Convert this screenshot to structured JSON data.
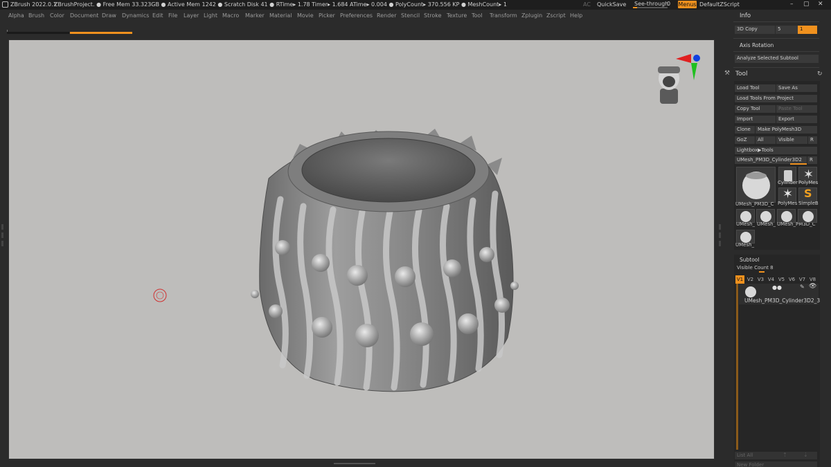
{
  "titlebar": {
    "app": "ZBrush 2022.0.1",
    "project": "ZBrushProject",
    "stats": ". ● Free Mem 33.323GB ● Active Mem 1242 ● Scratch Disk 41 ●  RTime▸ 1.78 Timer▸ 1.684 ATime▸ 0.004 ● PolyCount▸ 370.556 KP  ● MeshCount▸ 1",
    "ac": "AC",
    "quicksave": "QuickSave",
    "seethrough_label": "See-through",
    "seethrough_value": "0",
    "seethrough_level": 0.0,
    "menus": "Menus",
    "script": "DefaultZScript",
    "controls": [
      "–",
      "▢",
      "✕"
    ]
  },
  "menubar": [
    "Alpha",
    "Brush",
    "Color",
    "Document",
    "Draw",
    "Dynamics",
    "Edit",
    "File",
    "Layer",
    "Light",
    "Macro",
    "Marker",
    "Material",
    "Movie",
    "Picker",
    "Preferences",
    "Render",
    "Stencil",
    "Stroke",
    "Texture",
    "Tool",
    "Transform",
    "Zplugin",
    "Zscript",
    "Help"
  ],
  "panel": {
    "info": "Info",
    "copy3d": "3D Copy",
    "copy3d_value": "5",
    "copy3d_value2": "1",
    "axis_rotation": "Axis Rotation",
    "analyze": "Analyze Selected Subtool",
    "tool_title": "Tool",
    "load_tool": "Load Tool",
    "save_as": "Save As",
    "load_project": "Load Tools From Project",
    "copy_tool": "Copy Tool",
    "paste_tool": "Paste Tool",
    "import": "Import",
    "export": "Export",
    "clone": "Clone",
    "make_polymesh": "Make PolyMesh3D",
    "goz": "GoZ",
    "all": "All",
    "visible": "Visible",
    "r": "R",
    "lightbox": "Lightbox▶Tools",
    "current_tool": "UMesh_PM3D_Cylinder3D2",
    "current_tool_r": "R",
    "thumbs": {
      "main": "UMesh_PM3D_C",
      "cyl": "Cylinder",
      "poly1": "PolyMes",
      "poly2": "PolyMes",
      "simple": "SimpleB",
      "u1": "UMesh_",
      "u2": "UMesh_",
      "u3": "UMesh_PM3D_C",
      "u4": "UMesh_"
    },
    "subtool": "Subtool",
    "visible_count": "Visible Count 8",
    "vbuttons": [
      "V1",
      "V2",
      "V3",
      "V4",
      "V5",
      "V6",
      "V7",
      "V8"
    ],
    "subtool_item": "UMesh_PM3D_Cylinder3D2_3",
    "list_all": "List All",
    "new_folder": "New Folder"
  }
}
